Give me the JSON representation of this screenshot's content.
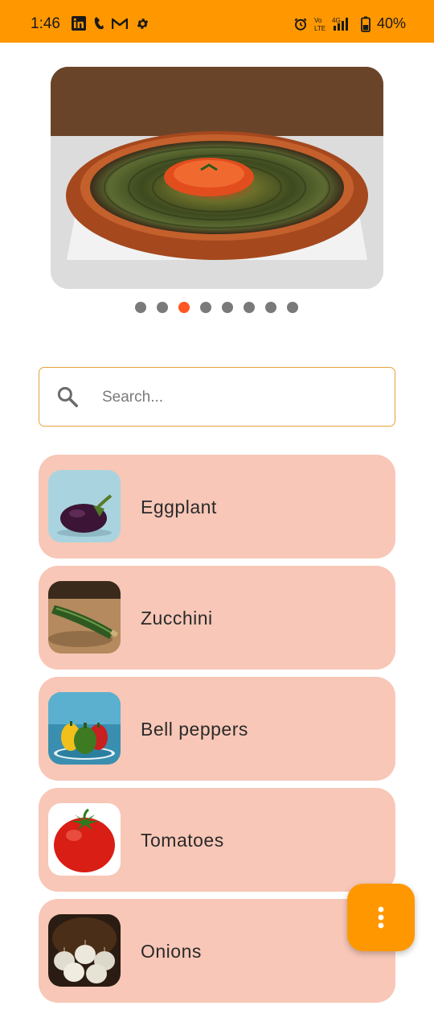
{
  "status_bar": {
    "time": "1:46",
    "battery": "40%",
    "left_icons": [
      "linkedin-icon",
      "phone-call-icon",
      "gmail-icon",
      "settings-icon"
    ],
    "right_icons": [
      "alarm-icon",
      "volte-icon",
      "signal-4g-icon",
      "battery-icon"
    ]
  },
  "carousel": {
    "image": "ratatouille-dish",
    "dot_count": 8,
    "active_index": 2
  },
  "search": {
    "placeholder": "Search...",
    "value": ""
  },
  "ingredients": [
    {
      "label": "Eggplant",
      "thumb": "eggplant"
    },
    {
      "label": "Zucchini",
      "thumb": "zucchini"
    },
    {
      "label": "Bell peppers",
      "thumb": "bell-peppers"
    },
    {
      "label": "Tomatoes",
      "thumb": "tomato"
    },
    {
      "label": "Onions",
      "thumb": "onions"
    }
  ],
  "fab": {
    "icon": "more-vert-icon"
  },
  "colors": {
    "accent": "#FF9800",
    "active_dot": "#FF5722",
    "card_bg": "#F8C7B7",
    "search_border": "#E6A23C"
  }
}
